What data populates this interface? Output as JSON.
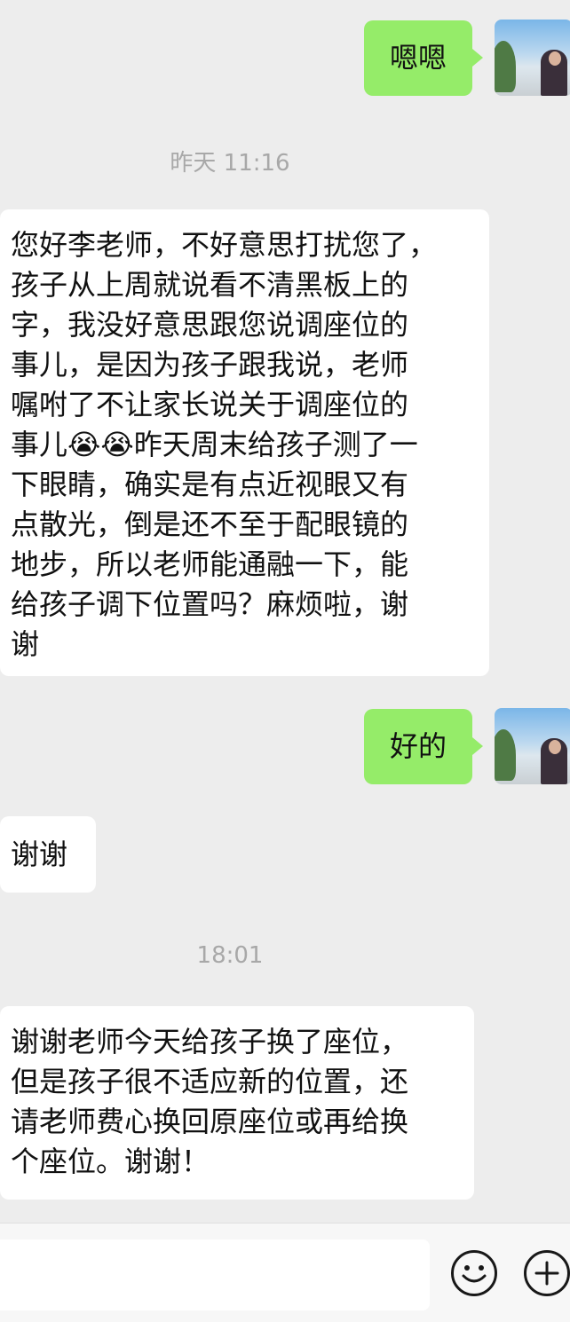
{
  "messages": {
    "m1": "嗯嗯",
    "m2": "您好李老师，不好意思打扰您了，\n孩子从上周就说看不清黑板上的\n字，我没好意思跟您说调座位的\n事儿，是因为孩子跟我说，老师\n嘱咐了不让家长说关于调座位的\n事儿😭😭昨天周末给孩子测了一\n下眼睛，确实是有点近视眼又有\n点散光，倒是还不至于配眼镜的\n地步，所以老师能通融一下，能\n给孩子调下位置吗？麻烦啦，谢\n谢",
    "m3": "好的",
    "m4": "谢谢",
    "m5": "谢谢老师今天给孩子换了座位，\n但是孩子很不适应新的位置，还\n请老师费心换回原座位或再给换\n个座位。谢谢！"
  },
  "timestamps": {
    "t1": "昨天 11:16",
    "t2": "18:01"
  },
  "input_bar": {
    "emoji_icon": "smiley-face-icon",
    "plus_icon": "plus-circle-icon"
  },
  "colors": {
    "self_bubble": "#95ec69",
    "other_bubble": "#ffffff",
    "background": "#ededed"
  }
}
